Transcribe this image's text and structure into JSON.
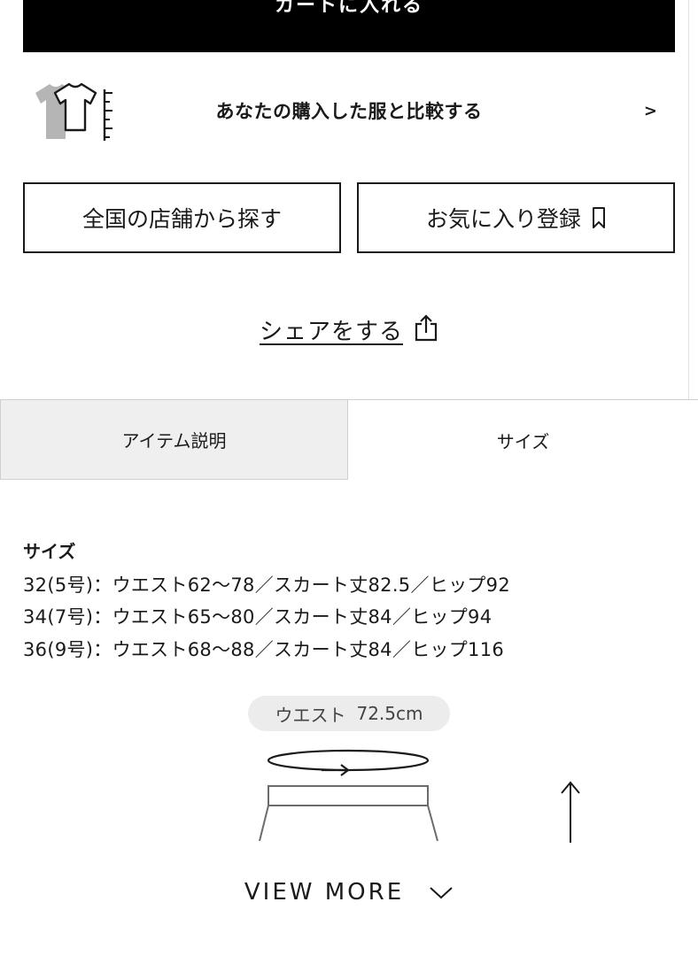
{
  "cart_button": {
    "label": "カートに入れる"
  },
  "compare": {
    "label": "あなたの購入した服と比較する",
    "chevron": ">"
  },
  "buttons": {
    "store_search": "全国の店舗から探す",
    "favorite": "お気に入り登録"
  },
  "share": {
    "label": "シェアをする"
  },
  "tabs": [
    {
      "label": "アイテム説明",
      "active": false
    },
    {
      "label": "サイズ",
      "active": true
    }
  ],
  "size_info": {
    "heading": "サイズ",
    "rows": [
      "32(5号)：ウエスト62〜78／スカート丈82.5／ヒップ92",
      "34(7号)：ウエスト65〜80／スカート丈84／ヒップ94",
      "36(9号)：ウエスト68〜88／スカート丈84／ヒップ116"
    ]
  },
  "measurement": {
    "label": "ウエスト",
    "value": "72.5cm"
  },
  "view_more": {
    "label": "VIEW MORE"
  },
  "icons": {
    "compare": "tshirt-compare-icon",
    "favorite": "bookmark-icon",
    "share": "share-icon",
    "view_more": "chevron-down-icon",
    "scroll": "arrow-up-icon"
  },
  "colors": {
    "primary": "#000000",
    "tab_inactive_bg": "#efefef",
    "pill_bg": "#ececec"
  }
}
